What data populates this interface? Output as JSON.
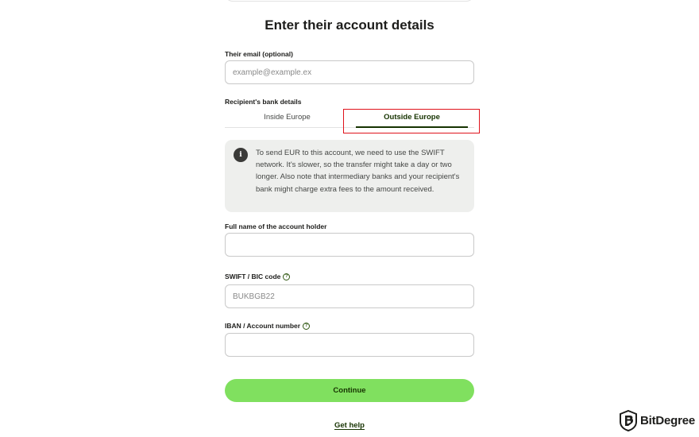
{
  "page": {
    "title": "Enter their account details"
  },
  "email": {
    "label": "Their email (optional)",
    "placeholder": "example@example.ex",
    "value": ""
  },
  "bank_details": {
    "label": "Recipient's bank details",
    "tabs": [
      {
        "label": "Inside Europe",
        "active": false
      },
      {
        "label": "Outside Europe",
        "active": true
      }
    ],
    "info": {
      "icon": "info-icon",
      "text": "To send EUR to this account, we need to use the SWIFT network. It's slower, so the transfer might take a day or two longer. Also note that intermediary banks and your recipient's bank might charge extra fees to the amount received."
    }
  },
  "account_holder": {
    "label": "Full name of the account holder",
    "value": ""
  },
  "swift": {
    "label": "SWIFT / BIC code",
    "placeholder": "BUKBGB22",
    "value": ""
  },
  "iban": {
    "label": "IBAN / Account number",
    "value": ""
  },
  "actions": {
    "continue_label": "Continue",
    "help_label": "Get help"
  },
  "watermark": {
    "text": "BitDegree"
  },
  "colors": {
    "accent": "#80e05f",
    "accent_dark": "#163300",
    "highlight": "#e0121b"
  }
}
